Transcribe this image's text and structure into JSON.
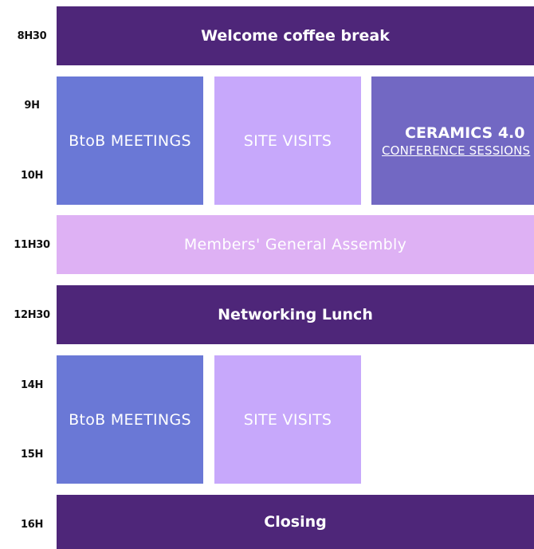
{
  "times": [
    "8H30",
    "9H",
    "10H",
    "11H30",
    "12H30",
    "14H",
    "15H",
    "16H"
  ],
  "colors": {
    "dark_purple": "#4e2679",
    "blue": "#6a78d6",
    "lavender": "#c7a8fb",
    "medium_purple": "#7268c3",
    "light_pink": "#deb1f4"
  },
  "blocks": {
    "welcome": "Welcome coffee break",
    "btob_am": "BtoB MEETINGS",
    "visits_am": "SITE VISITS",
    "ceramics_title": "CERAMICS 4.0",
    "ceramics_link": "CONFERENCE SESSIONS",
    "assembly": "Members' General Assembly",
    "lunch": "Networking Lunch",
    "btob_pm": "BtoB MEETINGS",
    "visits_pm": "SITE VISITS",
    "closing": "Closing"
  }
}
